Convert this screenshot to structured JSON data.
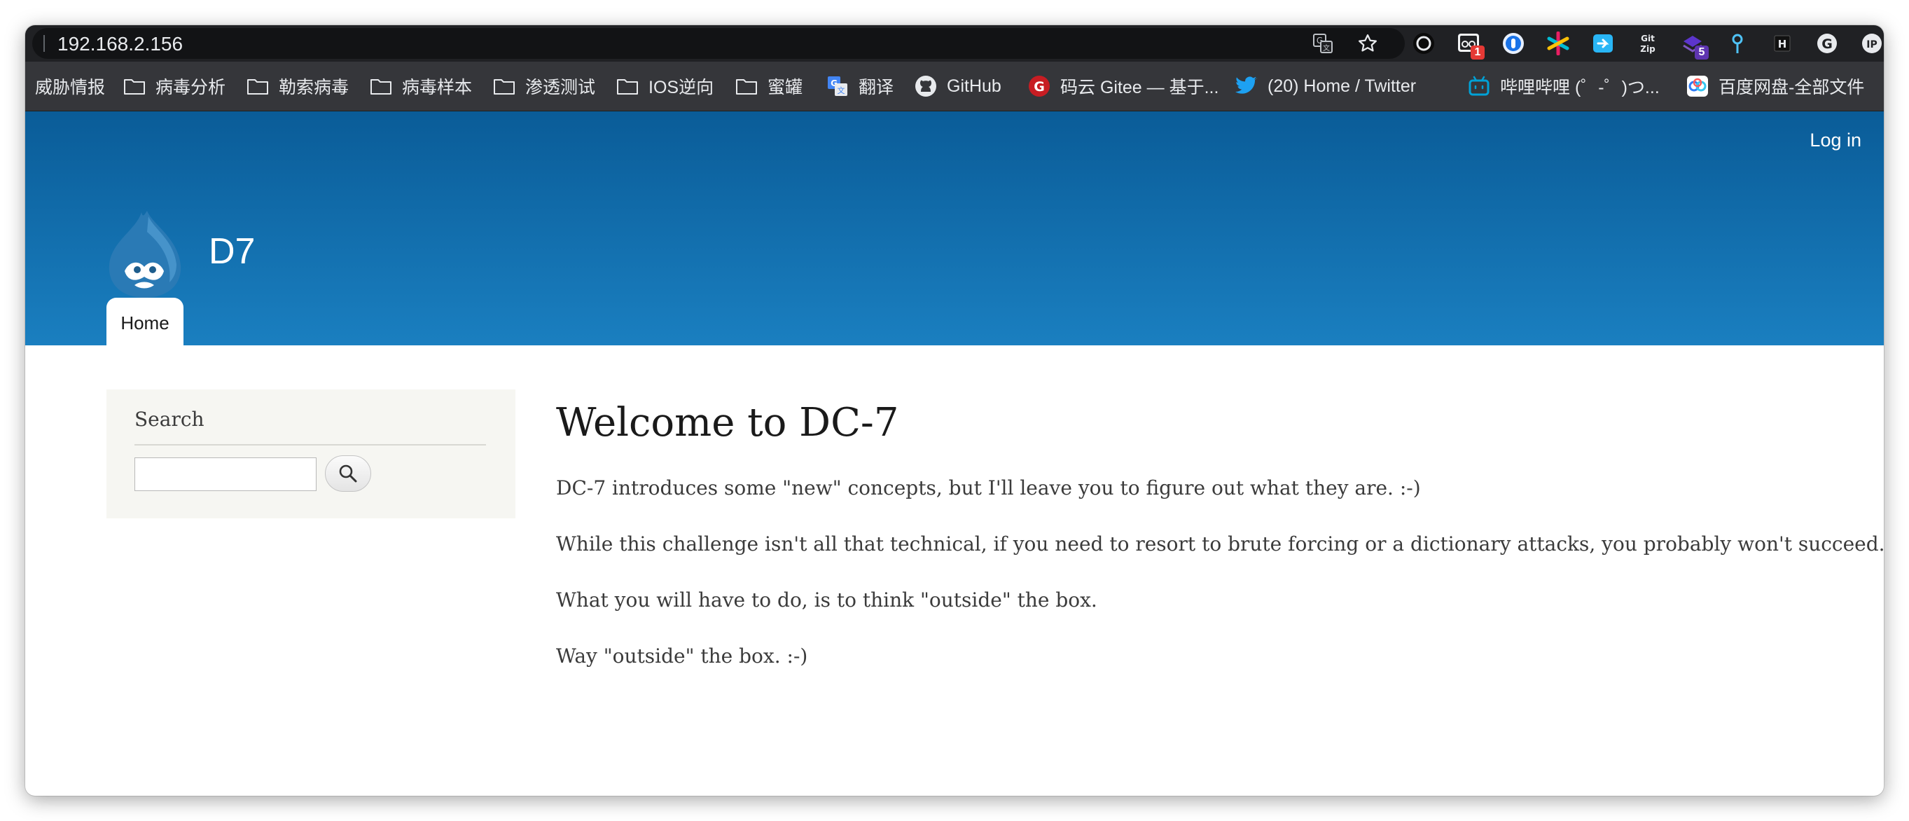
{
  "browser": {
    "url": "192.168.2.156",
    "extension_badges": {
      "mail": "1",
      "stack": "5"
    }
  },
  "bookmarks": [
    {
      "label": "威胁情报",
      "icon": "none"
    },
    {
      "label": "病毒分析",
      "icon": "folder-icon"
    },
    {
      "label": "勒索病毒",
      "icon": "folder-icon"
    },
    {
      "label": "病毒样本",
      "icon": "folder-icon"
    },
    {
      "label": "渗透测试",
      "icon": "folder-icon"
    },
    {
      "label": "IOS逆向",
      "icon": "folder-icon"
    },
    {
      "label": "蜜罐",
      "icon": "folder-icon"
    },
    {
      "label": "翻译",
      "icon": "google-translate-icon"
    },
    {
      "label": "GitHub",
      "icon": "github-icon"
    },
    {
      "label": "码云 Gitee — 基于...",
      "icon": "gitee-icon"
    },
    {
      "label": "(20) Home / Twitter",
      "icon": "twitter-icon"
    },
    {
      "label": "哔哩哔哩 (゜-゜)つ...",
      "icon": "bilibili-icon"
    },
    {
      "label": "百度网盘-全部文件",
      "icon": "baidu-netdisk-icon"
    }
  ],
  "site": {
    "name": "D7",
    "login_label": "Log in",
    "nav": {
      "home": "Home"
    }
  },
  "sidebar": {
    "search_title": "Search",
    "search_value": ""
  },
  "content": {
    "title": "Welcome to DC-7",
    "paragraphs": [
      "DC-7 introduces some \"new\" concepts, but I'll leave you to figure out what they are.  :-)",
      "While this challenge isn't all that technical, if you need to resort to brute forcing or a dictionary attacks, you probably won't succeed.",
      "What you will have to do, is to think \"outside\" the box.",
      "Way \"outside\" the box.  :-)"
    ]
  },
  "colors": {
    "header_top": "#0a5c98",
    "header_bottom": "#1a7fc0",
    "sidebar_bg": "#f6f6f2",
    "toolbar_bg": "#202124",
    "bookmarks_bg": "#35363a"
  }
}
